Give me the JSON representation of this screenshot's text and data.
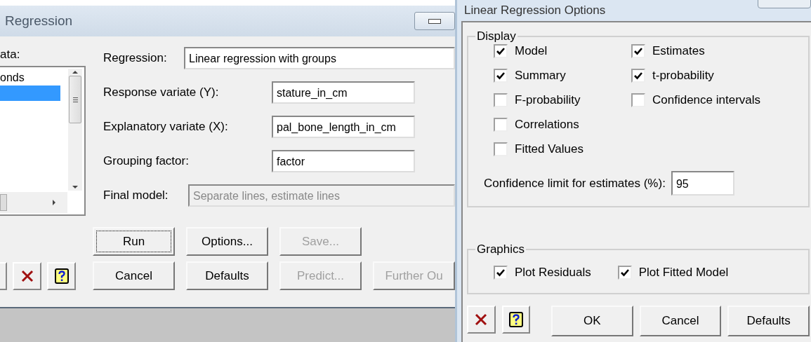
{
  "regression_window": {
    "title": "Regression",
    "data_list": {
      "label": "ata:",
      "items": [
        {
          "text": "onds",
          "selected": false
        },
        {
          "selected": true
        }
      ]
    },
    "fields": [
      {
        "label": "Regression:",
        "value": "Linear regression with groups",
        "kind": "wide",
        "disabled": false
      },
      {
        "label": "Response variate (Y):",
        "value": "stature_in_cm",
        "kind": "short",
        "disabled": false
      },
      {
        "label": "Explanatory variate (X):",
        "value": "pal_bone_length_in_cm",
        "kind": "short",
        "disabled": false
      },
      {
        "label": "Grouping factor:",
        "value": "factor",
        "kind": "short",
        "disabled": false
      },
      {
        "label": "Final model:",
        "value": "Separate lines, estimate lines",
        "kind": "wide",
        "disabled": true
      }
    ],
    "button_rows": [
      [
        {
          "label": "Run",
          "disabled": false,
          "focused": true
        },
        {
          "label": "Options...",
          "disabled": false,
          "focused": false
        },
        {
          "label": "Save...",
          "disabled": true,
          "focused": false
        }
      ],
      [
        {
          "label": "Cancel",
          "disabled": false,
          "focused": false
        },
        {
          "label": "Defaults",
          "disabled": false,
          "focused": false
        },
        {
          "label": "Predict...",
          "disabled": true,
          "focused": false
        },
        {
          "label": "Further Ou",
          "disabled": true,
          "focused": false
        }
      ]
    ]
  },
  "options_window": {
    "title": "Linear Regression Options",
    "display": {
      "title": "Display",
      "columns": [
        [
          {
            "label": "Model",
            "checked": true
          },
          {
            "label": "Summary",
            "checked": true
          },
          {
            "label": "F-probability",
            "checked": false
          },
          {
            "label": "Correlations",
            "checked": false
          },
          {
            "label": "Fitted Values",
            "checked": false
          }
        ],
        [
          {
            "label": "Estimates",
            "checked": true
          },
          {
            "label": "t-probability",
            "checked": true
          },
          {
            "label": "Confidence intervals",
            "checked": false
          }
        ]
      ],
      "confidence_limit": {
        "label": "Confidence limit for estimates (%):",
        "value": "95"
      }
    },
    "graphics": {
      "title": "Graphics",
      "items": [
        {
          "label": "Plot Residuals",
          "checked": true
        },
        {
          "label": "Plot Fitted Model",
          "checked": true
        }
      ]
    },
    "buttons": [
      {
        "label": "OK"
      },
      {
        "label": "Cancel"
      },
      {
        "label": "Defaults"
      }
    ]
  }
}
